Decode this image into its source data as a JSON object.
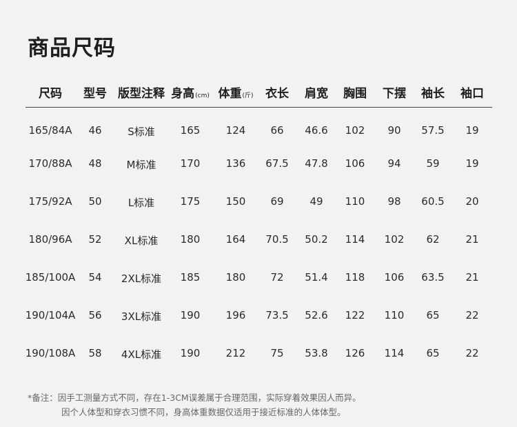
{
  "title": "商品尺码",
  "columns": [
    {
      "label": "尺码",
      "unit": ""
    },
    {
      "label": "型号",
      "unit": ""
    },
    {
      "label": "版型注释",
      "unit": ""
    },
    {
      "label": "身高",
      "unit": "(cm)"
    },
    {
      "label": "体重",
      "unit": "(斤)"
    },
    {
      "label": "衣长",
      "unit": ""
    },
    {
      "label": "肩宽",
      "unit": ""
    },
    {
      "label": "胸围",
      "unit": ""
    },
    {
      "label": "下摆",
      "unit": ""
    },
    {
      "label": "袖长",
      "unit": ""
    },
    {
      "label": "袖口",
      "unit": ""
    }
  ],
  "rows": [
    [
      "165/84A",
      "46",
      "S标准",
      "165",
      "124",
      "66",
      "46.6",
      "102",
      "90",
      "57.5",
      "19"
    ],
    [
      "170/88A",
      "48",
      "M标准",
      "170",
      "136",
      "67.5",
      "47.8",
      "106",
      "94",
      "59",
      "19"
    ],
    [
      "175/92A",
      "50",
      "L标准",
      "175",
      "150",
      "69",
      "49",
      "110",
      "98",
      "60.5",
      "20"
    ],
    [
      "180/96A",
      "52",
      "XL标准",
      "180",
      "164",
      "70.5",
      "50.2",
      "114",
      "102",
      "62",
      "21"
    ],
    [
      "185/100A",
      "54",
      "2XL标准",
      "185",
      "180",
      "72",
      "51.4",
      "118",
      "106",
      "63.5",
      "21"
    ],
    [
      "190/104A",
      "56",
      "3XL标准",
      "190",
      "196",
      "73.5",
      "52.6",
      "122",
      "110",
      "65",
      "22"
    ],
    [
      "190/108A",
      "58",
      "4XL标准",
      "190",
      "212",
      "75",
      "53.8",
      "126",
      "114",
      "65",
      "22"
    ]
  ],
  "note": {
    "line1": "*备注：因手工测量方式不同，存在1-3CM误差属于合理范围，实际穿着效果因人而异。",
    "line2": "因个人体型和穿衣习惯不同，身高体重数据仅适用于接近标准的人体体型。"
  }
}
